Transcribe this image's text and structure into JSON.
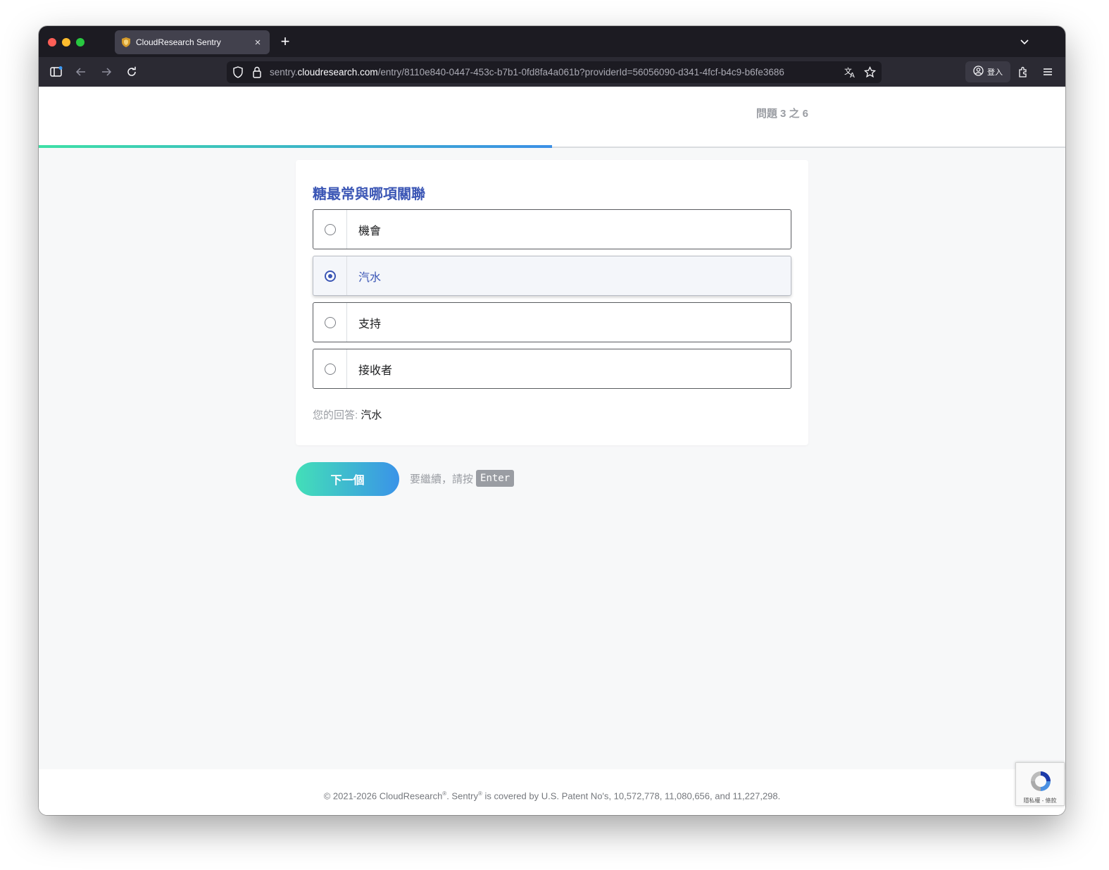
{
  "browser": {
    "tab_title": "CloudResearch Sentry",
    "url_prefix": "sentry.",
    "url_host": "cloudresearch.com",
    "url_path": "/entry/8110e840-0447-453c-b7b1-0fd8fa4a061b?providerId=56056090-d341-4fcf-b4c9-b6fe3686",
    "signin_label": "登入"
  },
  "survey": {
    "counter": "問題 3 之 6",
    "progress": 0.5,
    "question": "糖最常與哪項關聯",
    "options": [
      {
        "label": "機會",
        "selected": false
      },
      {
        "label": "汽水",
        "selected": true
      },
      {
        "label": "支持",
        "selected": false
      },
      {
        "label": "接收者",
        "selected": false
      }
    ],
    "answer_prefix": "您的回答: ",
    "answer_value": "汽水",
    "next_label": "下一個",
    "hint_text": "要繼續，請按",
    "hint_key": "Enter"
  },
  "footer": {
    "part1": "© 2021-2026 CloudResearch",
    "reg1": "®",
    "part2": ". Sentry",
    "reg2": "®",
    "part3": " is covered by U.S. Patent No's, 10,572,778, 11,080,656, and 11,227,298."
  },
  "recaptcha": {
    "text": "隱私權 - 條款"
  },
  "colors": {
    "accent": "#3b56b5",
    "progress_start": "#3ee0a6",
    "progress_end": "#3b8fe6"
  }
}
